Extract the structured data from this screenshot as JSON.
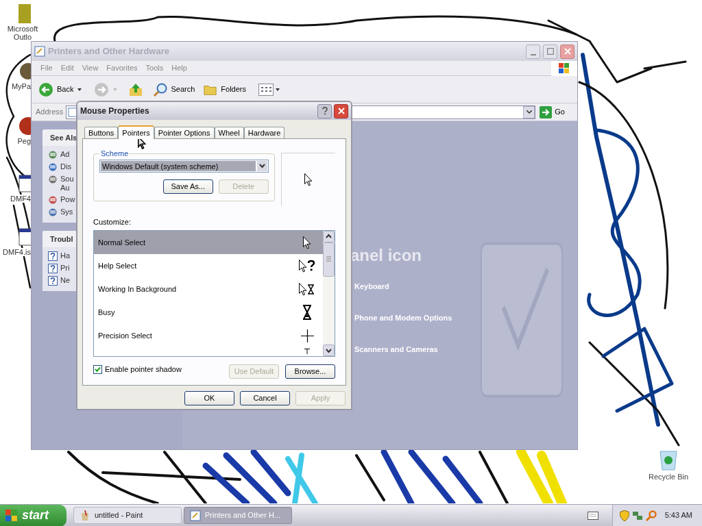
{
  "desktop": {
    "icons": [
      {
        "label": "Microsoft Outlo"
      },
      {
        "label": "MyPa"
      },
      {
        "label": "Peg"
      },
      {
        "label": "DMF4"
      },
      {
        "label": "DMF4.is"
      }
    ],
    "recycle_bin": "Recycle Bin"
  },
  "explorer": {
    "title": "Printers and Other Hardware",
    "menu": [
      "File",
      "Edit",
      "View",
      "Favorites",
      "Tools",
      "Help"
    ],
    "back": "Back",
    "search": "Search",
    "folders": "Folders",
    "address_label": "Address",
    "go": "Go",
    "task_panes": [
      {
        "title": "See Als",
        "items": [
          "Ad",
          "Dis",
          "Sou Au",
          "Pow",
          "Sys"
        ]
      },
      {
        "title": "Troubl",
        "items": [
          "Ha",
          "Pri",
          "Ne"
        ]
      }
    ],
    "heading": "anel icon",
    "links": [
      "Keyboard",
      "Phone and Modem Options",
      "Scanners and Cameras"
    ]
  },
  "dialog": {
    "title": "Mouse Properties",
    "tabs": [
      {
        "label": "Buttons",
        "selected": false
      },
      {
        "label": "Pointers",
        "selected": true
      },
      {
        "label": "Pointer Options",
        "selected": false
      },
      {
        "label": "Wheel",
        "selected": false
      },
      {
        "label": "Hardware",
        "selected": false
      }
    ],
    "scheme": {
      "legend": "Scheme",
      "value": "Windows Default (system scheme)",
      "buttons": [
        {
          "label": "Save As...",
          "disabled": false
        },
        {
          "label": "Delete",
          "disabled": true
        }
      ]
    },
    "customize_label": "Customize:",
    "pointers": [
      {
        "name": "Normal Select",
        "selected": true
      },
      {
        "name": "Help Select",
        "selected": false
      },
      {
        "name": "Working In Background",
        "selected": false
      },
      {
        "name": "Busy",
        "selected": false
      },
      {
        "name": "Precision Select",
        "selected": false
      }
    ],
    "shadow": {
      "label": "Enable pointer shadow",
      "checked": true
    },
    "list_buttons": [
      {
        "label": "Use Default",
        "disabled": true
      },
      {
        "label": "Browse...",
        "disabled": false
      }
    ],
    "footer": [
      {
        "label": "OK",
        "disabled": false
      },
      {
        "label": "Cancel",
        "disabled": false
      },
      {
        "label": "Apply",
        "disabled": true
      }
    ]
  },
  "taskbar": {
    "start": "start",
    "tasks": [
      {
        "label": "untitled - Paint",
        "selected": false
      },
      {
        "label": "Printers and Other H...",
        "selected": true
      }
    ],
    "clock": "5:43 AM"
  }
}
